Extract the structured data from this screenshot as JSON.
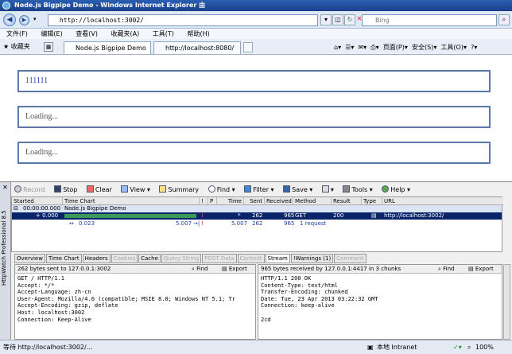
{
  "window": {
    "title": "Node.js Bigpipe Demo - Windows Internet Explorer 由"
  },
  "address": {
    "url": "http://localhost:3002/",
    "search_placeholder": "Bing"
  },
  "menu": [
    "文件(F)",
    "编辑(E)",
    "查看(V)",
    "收藏夹(A)",
    "工具(T)",
    "帮助(H)"
  ],
  "tabs": {
    "favorites": "收藏夹",
    "tab1": "Node.js Bigpipe Demo",
    "tab2": "http://localhost:8080/"
  },
  "toolbar_right": {
    "page": "页面(P)",
    "safety": "安全(S)",
    "tools": "工具(O)"
  },
  "content": {
    "boxes": [
      "111111",
      "Loading...",
      "Loading..."
    ]
  },
  "hw": {
    "side_label": "HttpWatch Professional 8.5",
    "toolbar": {
      "record": "Record",
      "stop": "Stop",
      "clear": "Clear",
      "view": "View",
      "summary": "Summary",
      "find": "Find",
      "filter": "Filter",
      "save": "Save",
      "tools": "Tools",
      "help": "Help"
    },
    "columns": {
      "started": "Started",
      "time_chart": "Time Chart",
      "bang": "!",
      "p": "P",
      "time": "Time",
      "sent": "Sent",
      "received": "Received",
      "method": "Method",
      "result": "Result",
      "type": "Type",
      "url": "URL"
    },
    "page_row": {
      "time": "00:00:00.000",
      "title": "Node.js Bigpipe Demo"
    },
    "req_row": {
      "started": "+ 0.000",
      "bang": "!",
      "time": "*",
      "sent": "262",
      "received": "965",
      "method": "GET",
      "result": "200",
      "url": "http://localhost:3002/"
    },
    "sum_row": {
      "t1": "0.023",
      "t2": "5.007",
      "bang": "!",
      "time": "5.007",
      "sent": "262",
      "received": "965",
      "requests": "1 request"
    },
    "detail_tabs": [
      "Overview",
      "Time Chart",
      "Headers",
      "Cookies",
      "Cache",
      "Query String",
      "POST Data",
      "Content",
      "Stream",
      "!Warnings (1)",
      "Comment"
    ],
    "left_pane": {
      "header": "262 bytes sent to 127.0.0.1:3002",
      "find": "Find",
      "export": "Export",
      "body": "GET / HTTP/1.1\nAccept: */*\nAccept-Language: zh-cn\nUser-Agent: Mozilla/4.0 (compatible; MSIE 8.0; Windows NT 5.1; Tr\nAccept-Encoding: gzip, deflate\nHost: localhost:3002\nConnection: Keep-Alive"
    },
    "right_pane": {
      "header": "965 bytes received by 127.0.0.1:4417 in 3 chunks",
      "find": "Find",
      "export": "Export",
      "body": "HTTP/1.1 200 OK\nContent-Type: text/html\nTransfer-Encoding: chunked\nDate: Tue, 23 Apr 2013 03:22:32 GMT\nConnection: keep-alive\n\n2cd"
    }
  },
  "status": {
    "left": "等待 http://localhost:3002/...",
    "zone": "本地 Intranet",
    "zoom": "100%"
  }
}
